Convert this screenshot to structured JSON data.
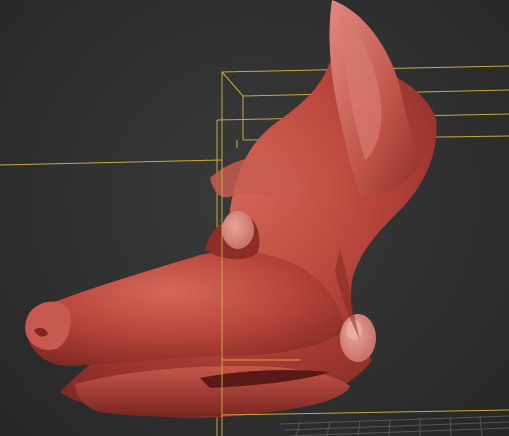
{
  "viewport": {
    "view": "perspective",
    "shading": "default-shading",
    "background_color": "#2e2e2e",
    "selection_box_color": "#c9a73a",
    "grid_color": "#4a4a4a"
  },
  "scene": {
    "object": {
      "icon": "wolf-head-mesh-icon",
      "color": "#b5463c",
      "selected": true
    }
  }
}
